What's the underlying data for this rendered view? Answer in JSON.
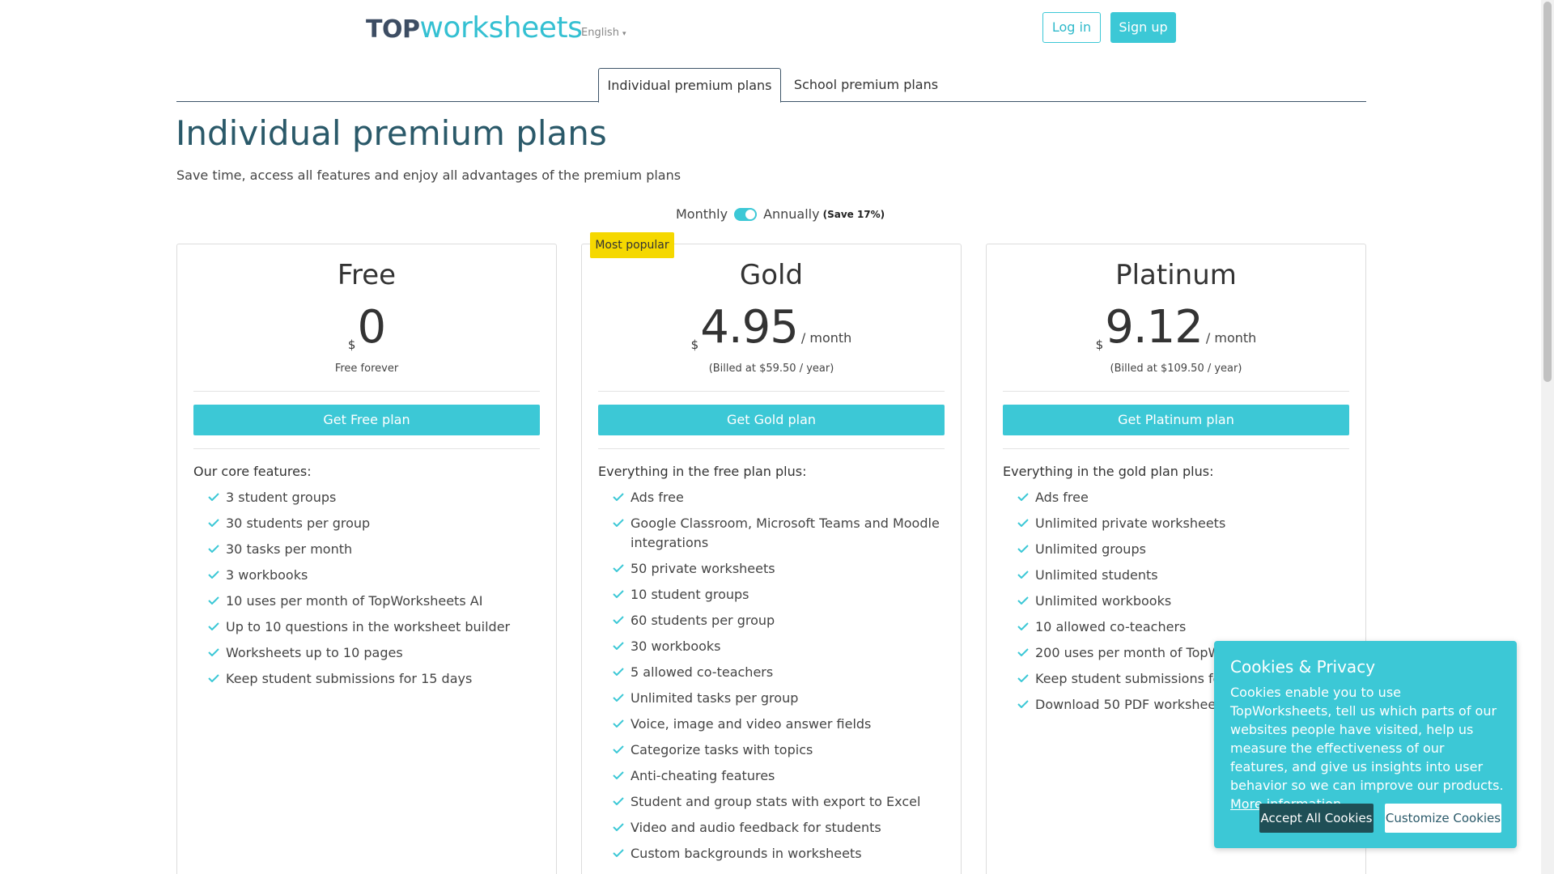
{
  "header": {
    "logo_top": "TOP",
    "logo_worksheets": "worksheets",
    "language": "English",
    "login_label": "Log in",
    "signup_label": "Sign up"
  },
  "tabs": [
    {
      "label": "Individual premium plans",
      "active": true
    },
    {
      "label": "School premium plans",
      "active": false
    }
  ],
  "page": {
    "title": "Individual premium plans",
    "subtitle": "Save time, access all features and enjoy all advantages of the premium plans"
  },
  "billing": {
    "monthly": "Monthly",
    "annually": "Annually",
    "save": "(Save 17%)",
    "annual_selected": true
  },
  "plans": {
    "free": {
      "name": "Free",
      "currency": "$",
      "amount": "0",
      "period": "",
      "billed": "Free forever",
      "button": "Get Free plan",
      "intro": "Our core features:",
      "features": [
        "3 student groups",
        "30 students per group",
        "30 tasks per month",
        "3 workbooks",
        "10 uses per month of TopWorksheets AI",
        "Up to 10 questions in the worksheet builder",
        "Worksheets up to 10 pages",
        "Keep student submissions for 15 days"
      ]
    },
    "gold": {
      "badge": "Most popular",
      "name": "Gold",
      "currency": "$",
      "amount": "4.95",
      "period": "/ month",
      "billed": "(Billed at $59.50 / year)",
      "button": "Get Gold plan",
      "intro": "Everything in the free plan plus:",
      "features": [
        "Ads free",
        "Google Classroom, Microsoft Teams and Moodle integrations",
        "50 private worksheets",
        "10 student groups",
        "60 students per group",
        "30 workbooks",
        "5 allowed co-teachers",
        "Unlimited tasks per group",
        "Voice, image and video answer fields",
        "Categorize tasks with topics",
        "Anti-cheating features",
        "Student and group stats with export to Excel",
        "Video and audio feedback for students",
        "Custom backgrounds in worksheets"
      ]
    },
    "platinum": {
      "name": "Platinum",
      "currency": "$",
      "amount": "9.12",
      "period": "/ month",
      "billed": "(Billed at $109.50 / year)",
      "button": "Get Platinum plan",
      "intro": "Everything in the gold plan plus:",
      "features": [
        "Ads free",
        "Unlimited private worksheets",
        "Unlimited groups",
        "Unlimited students",
        "Unlimited workbooks",
        "10 allowed co-teachers",
        "200 uses per month of TopWo",
        "Keep student submissions for",
        "Download 50 PDF worksheets"
      ]
    }
  },
  "cookie": {
    "title": "Cookies & Privacy",
    "text": "Cookies enable you to use TopWorksheets, tell us which parts of our websites people have visited, help us measure the effectiveness of our features, and give us insights into user behavior so we can improve our products.",
    "more": "More information",
    "accept": "Accept All Cookies",
    "customize": "Customize Cookies"
  },
  "colors": {
    "accent": "#3cc8d6",
    "title": "#2a5969",
    "badge": "#f5d800",
    "cookie_accept": "#1f4f56"
  }
}
